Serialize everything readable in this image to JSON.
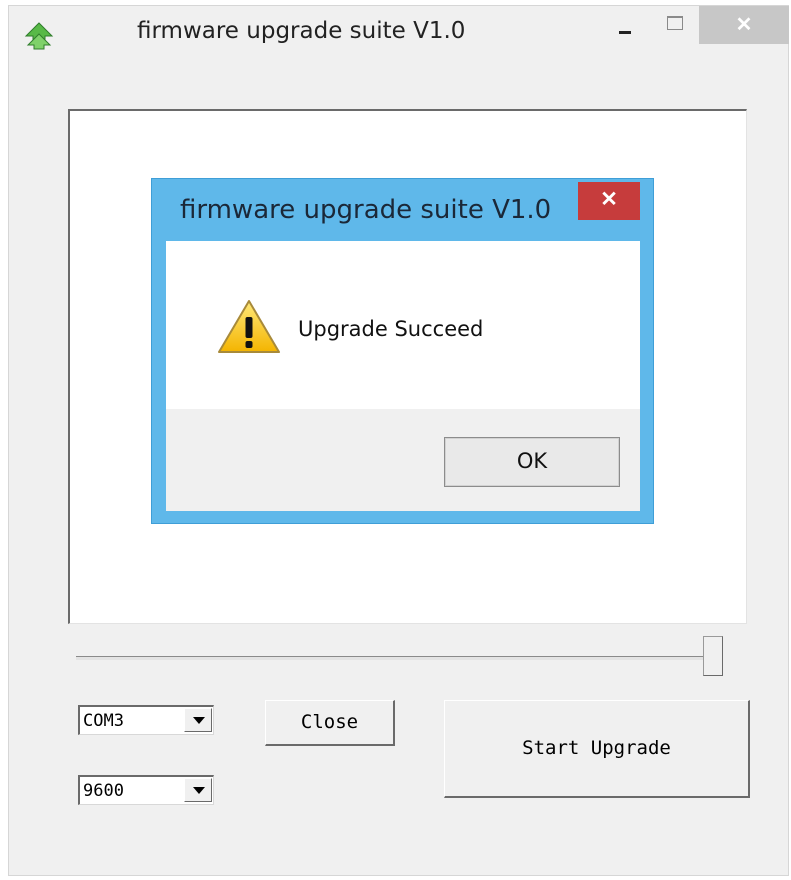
{
  "window": {
    "title": "firmware upgrade suite V1.0",
    "icon": "green-up-arrow-icon",
    "controls": {
      "minimize": "minimize-icon",
      "maximize": "maximize-icon",
      "close": "close-icon"
    }
  },
  "log": {
    "content": ""
  },
  "progress": {
    "value_percent": 100
  },
  "serial": {
    "port": {
      "selected": "COM3"
    },
    "baud": {
      "selected": "9600"
    }
  },
  "buttons": {
    "close_label": "Close",
    "start_label": "Start Upgrade"
  },
  "dialog": {
    "title": "firmware upgrade  suite V1.0",
    "message": "Upgrade Succeed",
    "icon": "warning-icon",
    "ok_label": "OK",
    "accent_color": "#5fb8ea",
    "close_color": "#c63c3c"
  }
}
